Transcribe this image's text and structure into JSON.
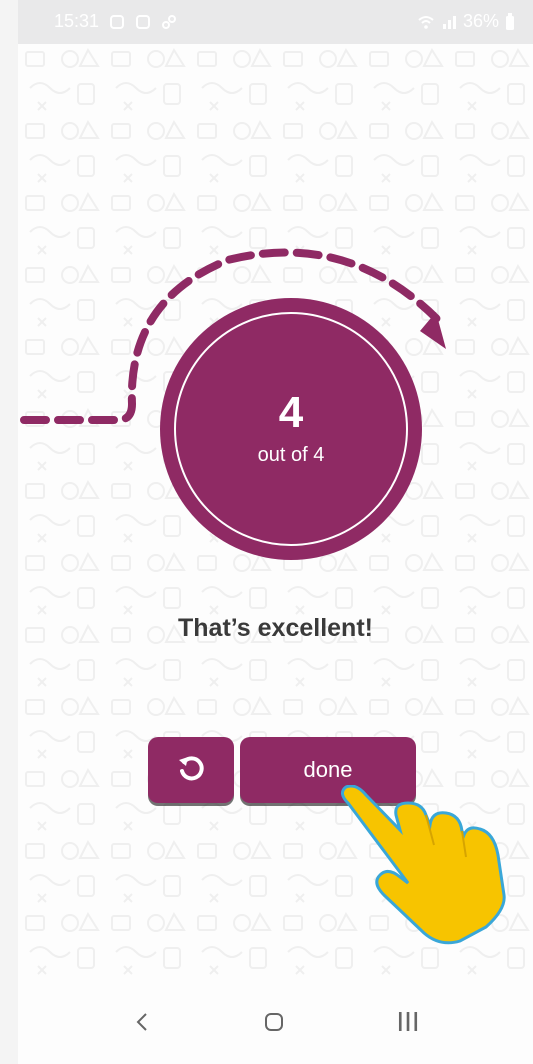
{
  "status_bar": {
    "time": "15:31",
    "battery": "36%"
  },
  "result": {
    "score": "4",
    "out_of": "out of 4",
    "message": "That’s excellent!"
  },
  "actions": {
    "retry_icon": "rotate-ccw-icon",
    "done_label": "done"
  },
  "navbar": {
    "recents_label": "III"
  },
  "colors": {
    "accent": "#8f2a64",
    "hand": "#f7c400",
    "hand_outline": "#3aa7d8",
    "text_dark": "#3a3a3a"
  }
}
